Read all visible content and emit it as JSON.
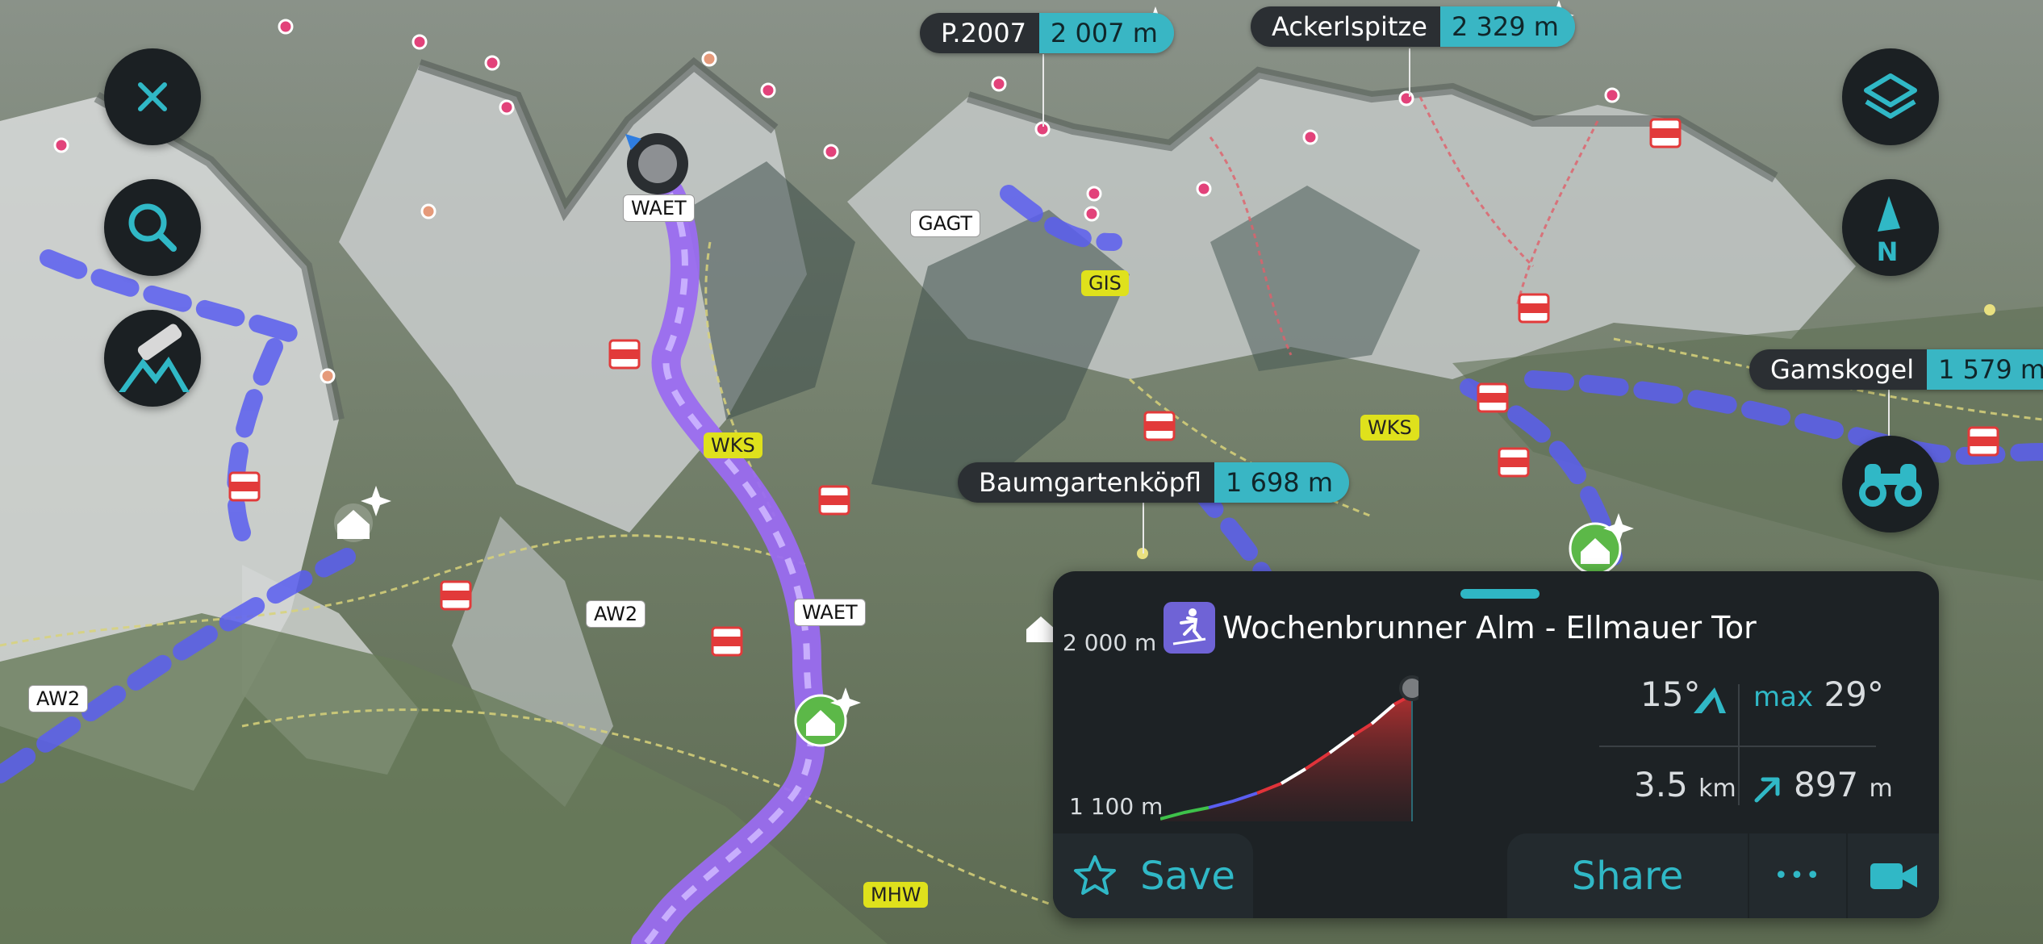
{
  "controls": {
    "close_icon": "close-icon",
    "search_icon": "search-icon",
    "mode_icon": "mountain-camera-icon",
    "layers_icon": "layers-icon",
    "compass_label": "N",
    "binoculars_icon": "binoculars-icon"
  },
  "peaks": [
    {
      "name": "P.2007",
      "elevation": "2 007 m"
    },
    {
      "name": "Ackerlspitze",
      "elevation": "2 329 m"
    },
    {
      "name": "Gamskogel",
      "elevation": "1 579 m"
    },
    {
      "name": "Baumgartenköpfl",
      "elevation": "1 698 m"
    }
  ],
  "trail_labels": {
    "waet_top": "WAET",
    "gagt": "GAGT",
    "gis": "GIS",
    "wks_1": "WKS",
    "wks_2": "WKS",
    "aw2_1": "AW2",
    "aw2_2": "AW2",
    "waet_mid": "WAET",
    "mhw": "MHW"
  },
  "route_panel": {
    "title": "Wochenbrunner Alm - Ellmauer Tor",
    "elev_max_label": "2 000 m",
    "elev_min_label": "1 100 m",
    "slope": "15°",
    "max_label": "max",
    "max_slope": "29°",
    "distance_value": "3.5",
    "distance_unit": "km",
    "ascent_value": "897",
    "ascent_unit": "m",
    "save_label": "Save",
    "share_label": "Share",
    "more_label": "•••",
    "video_icon": "video-camera-icon"
  },
  "colors": {
    "accent": "#30b8c6",
    "panel_bg": "#1d2225",
    "route": "#9a6cf0",
    "ski_track": "#5a5ef0"
  }
}
